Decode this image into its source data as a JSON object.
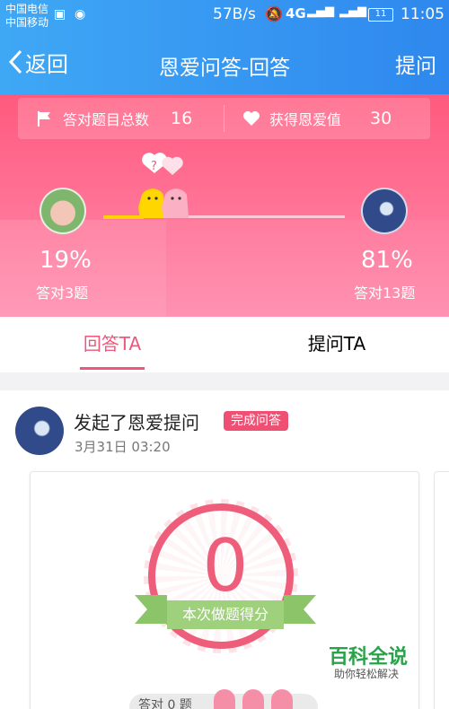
{
  "status_bar": {
    "carrier_1": "中国电信",
    "carrier_2": "中国移动",
    "net_speed": "57B/s",
    "network": "4G",
    "battery": "11",
    "time": "11:05"
  },
  "nav": {
    "back_label": "返回",
    "title": "恩爱问答-回答",
    "action_label": "提问"
  },
  "stats": {
    "correct_label": "答对题目总数",
    "correct_value": "16",
    "love_label": "获得恩爱值",
    "love_value": "30"
  },
  "players": {
    "left": {
      "percent": "19%",
      "detail": "答对3题"
    },
    "right": {
      "percent": "81%",
      "detail": "答对13题"
    }
  },
  "tabs": [
    {
      "label": "回答TA",
      "active": true
    },
    {
      "label": "提问TA",
      "active": false
    }
  ],
  "feed": {
    "title": "发起了恩爱提问",
    "badge": "完成问答",
    "time": "3月31日 03:20",
    "score": "0",
    "score_caption": "本次做题得分",
    "wrong_label": "答对 0 题"
  },
  "watermark": {
    "title": "百科全说",
    "subtitle": "助你轻松解决"
  },
  "colors": {
    "header_blue": "#2f88ee",
    "accent_pink": "#f0557a",
    "ribbon_green": "#9fd07b"
  }
}
